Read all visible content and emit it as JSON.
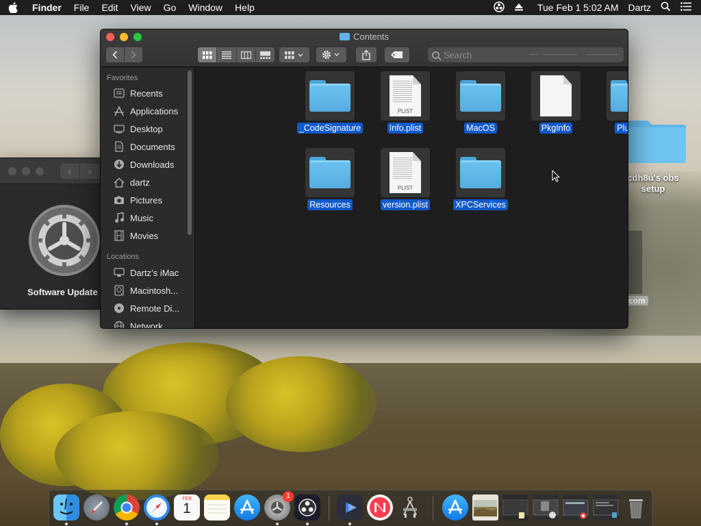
{
  "menubar": {
    "app_name": "Finder",
    "menus": [
      "File",
      "Edit",
      "View",
      "Go",
      "Window",
      "Help"
    ],
    "clock": "Tue Feb 1  5:02 AM",
    "user": "Dartz"
  },
  "desktop": {
    "folder_label": "cdh8u's obs setup",
    "partial_text": "com"
  },
  "sysprefs_window": {
    "label": "Software Update"
  },
  "finder": {
    "title": "Contents",
    "search_placeholder": "Search",
    "sidebar": {
      "favorites_header": "Favorites",
      "favorites": [
        {
          "label": "Recents",
          "icon": "recents-icon"
        },
        {
          "label": "Applications",
          "icon": "applications-icon"
        },
        {
          "label": "Desktop",
          "icon": "desktop-icon"
        },
        {
          "label": "Documents",
          "icon": "documents-icon"
        },
        {
          "label": "Downloads",
          "icon": "downloads-icon"
        },
        {
          "label": "dartz",
          "icon": "home-icon"
        },
        {
          "label": "Pictures",
          "icon": "pictures-icon"
        },
        {
          "label": "Music",
          "icon": "music-icon"
        },
        {
          "label": "Movies",
          "icon": "movies-icon"
        }
      ],
      "locations_header": "Locations",
      "locations": [
        {
          "label": "Dartz’s iMac",
          "icon": "imac-icon"
        },
        {
          "label": "Macintosh...",
          "icon": "disk-icon"
        },
        {
          "label": "Remote Di...",
          "icon": "remote-disc-icon"
        },
        {
          "label": "Network",
          "icon": "network-icon"
        }
      ]
    },
    "items": [
      {
        "name": "_CodeSignature",
        "kind": "folder"
      },
      {
        "name": "Info.plist",
        "kind": "plist",
        "ext": "PLIST"
      },
      {
        "name": "MacOS",
        "kind": "folder"
      },
      {
        "name": "PkgInfo",
        "kind": "blank"
      },
      {
        "name": "PlugIns",
        "kind": "folder"
      },
      {
        "name": "Resources",
        "kind": "folder"
      },
      {
        "name": "version.plist",
        "kind": "plist",
        "ext": "PLIST"
      },
      {
        "name": "XPCServices",
        "kind": "folder"
      }
    ]
  },
  "dock": {
    "apps": [
      "finder",
      "launchpad",
      "chrome",
      "safari",
      "calendar",
      "notes",
      "app-store",
      "system-preferences",
      "obs",
      "screen-recorder",
      "news",
      "automator",
      "app-store-downloads",
      "image",
      "screenshot-1",
      "screenshot-2",
      "screenshot-3",
      "screenshot-4",
      "trash"
    ],
    "calendar_month": "FEB",
    "calendar_day": "1",
    "sysprefs_badge": "1"
  }
}
